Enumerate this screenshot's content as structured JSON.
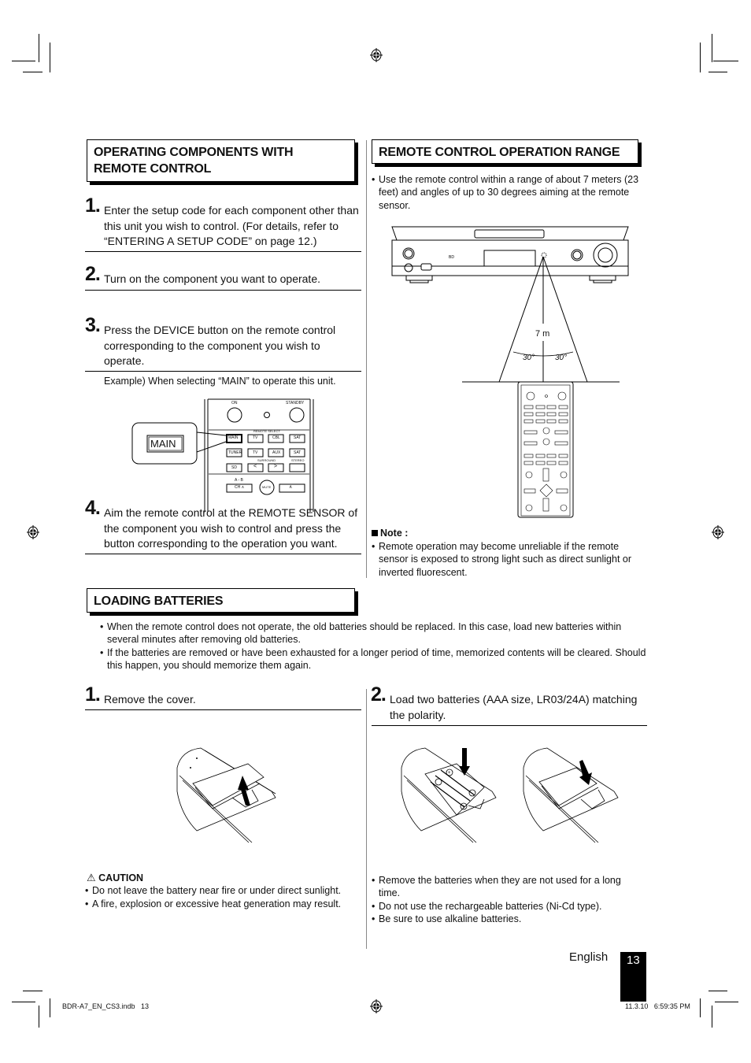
{
  "section_operating": {
    "title": "OPERATING COMPONENTS WITH REMOTE CONTROL",
    "steps": [
      {
        "num": "1.",
        "text": "Enter the setup code for each component other than this unit you wish to control. (For details, refer to “ENTERING A SETUP CODE” on page 12.)"
      },
      {
        "num": "2.",
        "text": "Turn on the component you want to operate."
      },
      {
        "num": "3.",
        "text": "Press the DEVICE button on the remote control corresponding to the component you wish to operate."
      },
      {
        "num": "4.",
        "text": "Aim the remote control at the REMOTE SENSOR of the component you wish to control and press the button corresponding to the operation you want."
      }
    ],
    "example": "Example) When selecting “MAIN” to operate this unit.",
    "remote_illustration": {
      "callout": "MAIN",
      "labels": {
        "on": "ON",
        "standby": "STANDBY",
        "remote_select": "REMOTE SELECT",
        "surround": "SURROUND",
        "stereo": "STEREO",
        "ab": "A - B",
        "mute": "MUTE"
      },
      "row1": [
        "MAIN",
        "TV",
        "CBL",
        "SAT"
      ],
      "row2": [
        "TUNER",
        "TV",
        "AUX",
        "SAT"
      ],
      "row3": [
        "SD",
        "<",
        ">",
        ""
      ],
      "row4": [
        "CH ∧",
        "∧"
      ]
    }
  },
  "section_range": {
    "title": "REMOTE CONTROL OPERATION RANGE",
    "bullet": "Use the remote control within a range of about 7 meters (23 feet) and angles of up to 30 degrees aiming at the remote sensor.",
    "diagram": {
      "distance": "7 m",
      "angle_left": "30°",
      "angle_right": "30°"
    },
    "note_title": "Note :",
    "note_bullet": "Remote operation may become unreliable if the remote sensor is exposed to strong light such as direct sunlight or inverted fluorescent."
  },
  "section_batteries": {
    "title": "LOADING BATTERIES",
    "bullets": [
      "When the remote control does not operate, the old batteries should be replaced. In this case, load new batteries within several minutes after removing old batteries.",
      "If the batteries are removed or have been exhausted for a longer period of time, memorized contents will be cleared. Should this happen, you should memorize them again."
    ],
    "steps": [
      {
        "num": "1.",
        "text": "Remove the cover."
      },
      {
        "num": "2.",
        "text": "Load two batteries (AAA size, LR03/24A) matching the polarity."
      }
    ],
    "caution_title": "CAUTION",
    "caution_bullets": [
      "Do not leave the battery near fire or under direct sunlight.",
      "A fire, explosion or excessive heat generation may result."
    ],
    "right_bullets": [
      "Remove the batteries when they are not used for a long time.",
      "Do not use the rechargeable batteries (Ni-Cd type).",
      "Be sure to use alkaline batteries."
    ]
  },
  "footer": {
    "language": "English",
    "page_number": "13",
    "file_slug": "BDR-A7_EN_CS3.indb   13",
    "timestamp": "11.3.10   6:59:35 PM"
  }
}
